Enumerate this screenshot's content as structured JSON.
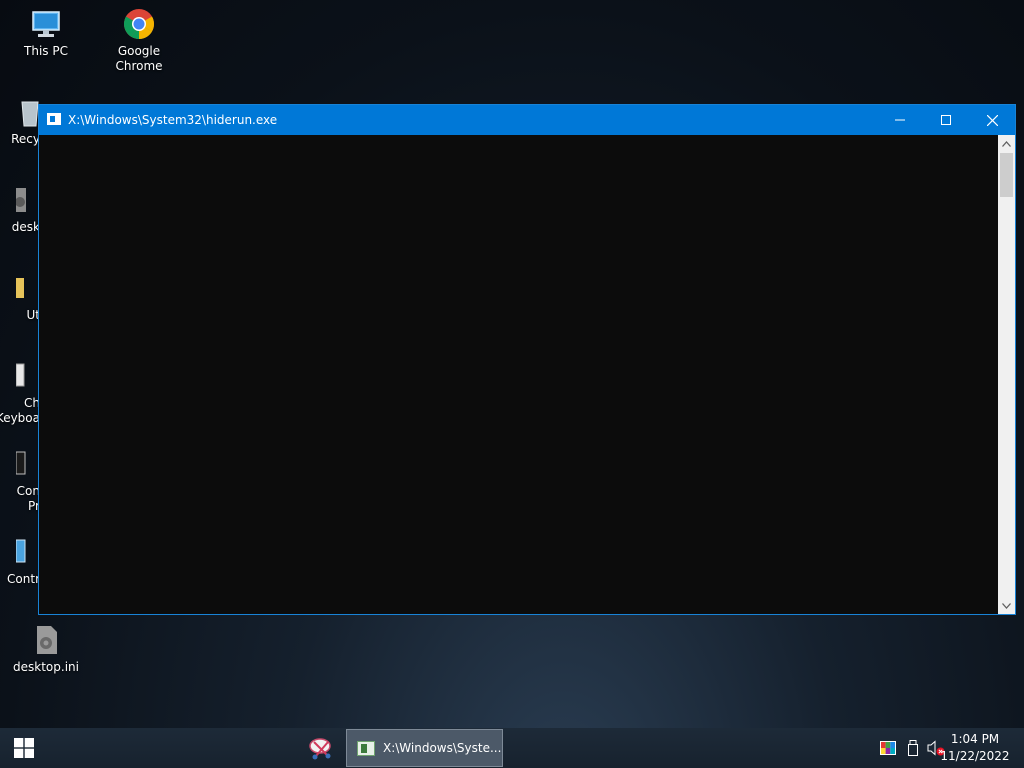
{
  "desktop": {
    "icons": [
      {
        "label": "This PC"
      },
      {
        "label": "Google Chrome"
      },
      {
        "label": "Recy"
      },
      {
        "label": "desk"
      },
      {
        "label": "Ut"
      },
      {
        "label": "Ch\nKeyboa"
      },
      {
        "label": "Con\nPr"
      },
      {
        "label": "Contr"
      },
      {
        "label": "desktop.ini"
      }
    ]
  },
  "window": {
    "title": "X:\\Windows\\System32\\hiderun.exe",
    "minimize_icon": "minimize-icon",
    "maximize_icon": "maximize-icon",
    "close_icon": "close-icon",
    "console_bg": "#0c0c0c",
    "titlebar_color": "#0078d7"
  },
  "taskbar": {
    "start_icon": "windows-logo-icon",
    "pinned_app_icon": "snipping-tool-icon",
    "task_item_label": "X:\\Windows\\Syste...",
    "tray": {
      "icons": [
        "color-palette-icon",
        "usb-drive-icon",
        "speaker-muted-icon"
      ]
    },
    "clock": {
      "time": "1:04 PM",
      "date": "11/22/2022"
    }
  }
}
